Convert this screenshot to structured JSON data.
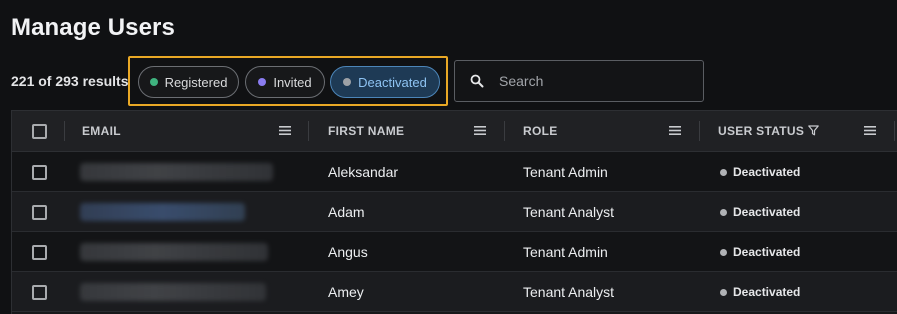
{
  "page": {
    "title": "Manage Users"
  },
  "results": {
    "count_text": "221 of 293 results"
  },
  "filters": {
    "chips": [
      {
        "label": "Registered",
        "dot_color": "#3fb37f",
        "selected": false
      },
      {
        "label": "Invited",
        "dot_color": "#8a7cf0",
        "selected": false
      },
      {
        "label": "Deactivated",
        "dot_color": "#9da1a6",
        "selected": true
      }
    ],
    "highlight_color": "#e9a825"
  },
  "search": {
    "placeholder": "Search",
    "value": ""
  },
  "table": {
    "columns": [
      {
        "label": "EMAIL"
      },
      {
        "label": "FIRST NAME"
      },
      {
        "label": "ROLE"
      },
      {
        "label": "USER STATUS"
      }
    ],
    "rows": [
      {
        "email": "",
        "first_name": "Aleksandar",
        "role": "Tenant Admin",
        "status": "Deactivated"
      },
      {
        "email": "",
        "first_name": "Adam",
        "role": "Tenant Analyst",
        "status": "Deactivated"
      },
      {
        "email": "",
        "first_name": "Angus",
        "role": "Tenant Admin",
        "status": "Deactivated"
      },
      {
        "email": "",
        "first_name": "Amey",
        "role": "Tenant Analyst",
        "status": "Deactivated"
      }
    ]
  }
}
